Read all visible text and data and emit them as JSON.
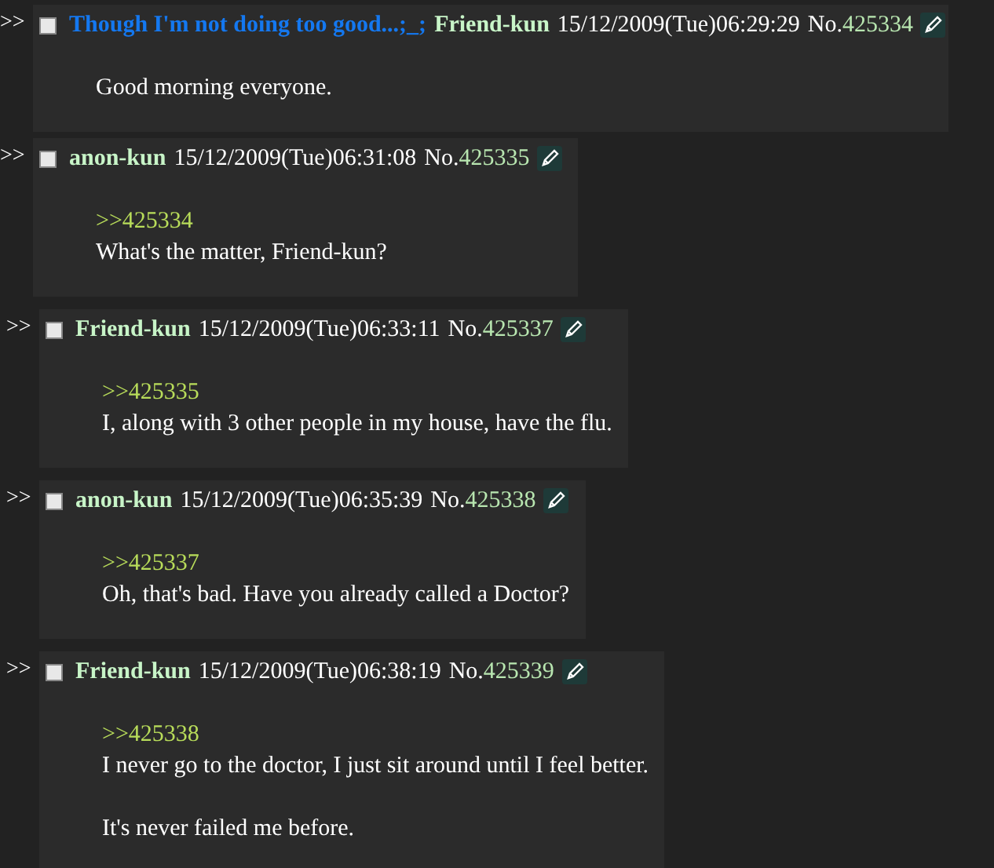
{
  "posts": [
    {
      "subject": "Though I'm not doing too good...;_;",
      "name": "Friend-kun",
      "date": "15/12/2009(Tue)06:29:29",
      "no_label": "No.",
      "number": "425334",
      "checked": false,
      "lines": [
        {
          "kind": "text",
          "text": "Good morning everyone."
        }
      ]
    },
    {
      "name": "anon-kun",
      "date": "15/12/2009(Tue)06:31:08",
      "no_label": "No.",
      "number": "425335",
      "checked": false,
      "lines": [
        {
          "kind": "quote",
          "text": ">>425334"
        },
        {
          "kind": "text",
          "text": "What's the matter, Friend-kun?"
        }
      ]
    },
    {
      "name": "Friend-kun",
      "date": "15/12/2009(Tue)06:33:11",
      "no_label": "No.",
      "number": "425337",
      "checked": false,
      "lines": [
        {
          "kind": "quote",
          "text": ">>425335"
        },
        {
          "kind": "text",
          "text": "I, along with 3 other people in my house, have the flu."
        }
      ]
    },
    {
      "name": "anon-kun",
      "date": "15/12/2009(Tue)06:35:39",
      "no_label": "No.",
      "number": "425338",
      "checked": false,
      "lines": [
        {
          "kind": "quote",
          "text": ">>425337"
        },
        {
          "kind": "text",
          "text": "Oh, that's bad. Have you already called a Doctor?"
        }
      ]
    },
    {
      "name": "Friend-kun",
      "date": "15/12/2009(Tue)06:38:19",
      "no_label": "No.",
      "number": "425339",
      "checked": false,
      "lines": [
        {
          "kind": "quote",
          "text": ">>425338"
        },
        {
          "kind": "text",
          "text": "I never go to the doctor, I just sit around until I feel better."
        },
        {
          "kind": "gap"
        },
        {
          "kind": "text",
          "text": "It's never failed me before."
        }
      ]
    }
  ],
  "arrow": ">>"
}
